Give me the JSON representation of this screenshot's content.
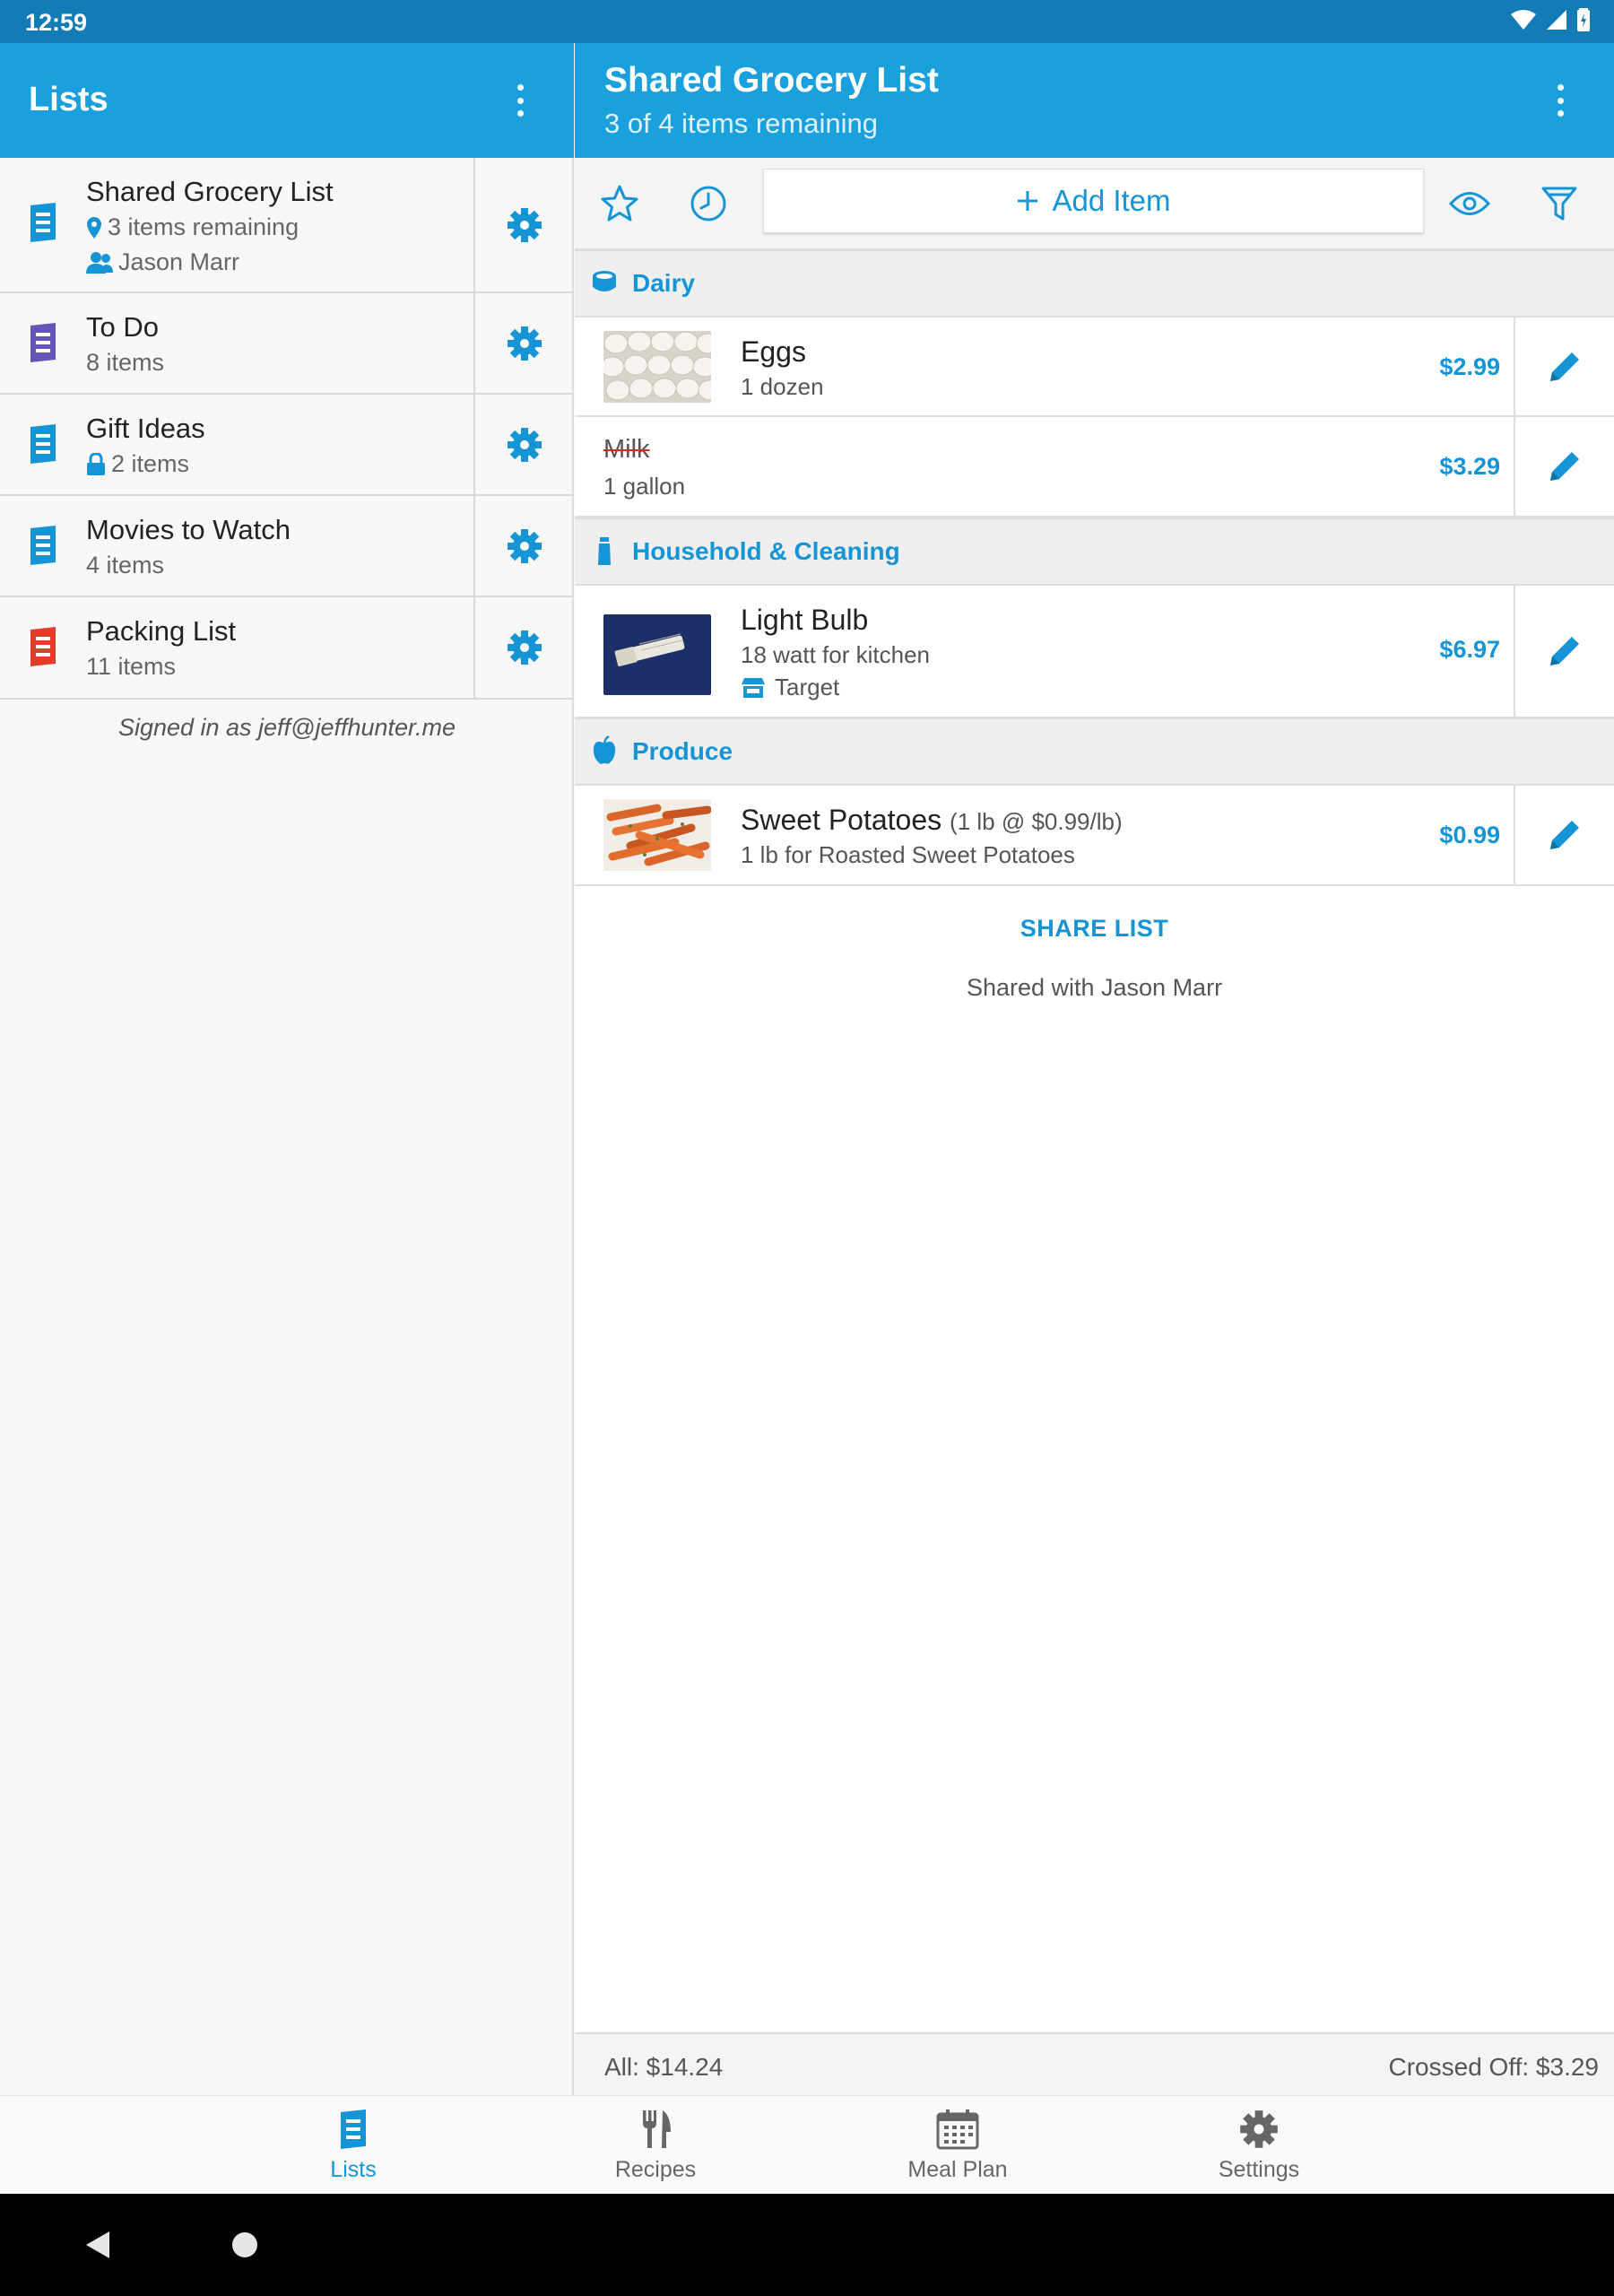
{
  "status": {
    "time": "12:59"
  },
  "left_header": {
    "title": "Lists"
  },
  "right_header": {
    "title": "Shared Grocery List",
    "subtitle": "3 of 4 items remaining"
  },
  "lists": [
    {
      "title": "Shared Grocery List",
      "subtitle": "3 items remaining",
      "extra": "Jason Marr",
      "color": "#1595d5",
      "subtitle_icon": "location-pin-icon",
      "extra_icon": "people-icon"
    },
    {
      "title": "To Do",
      "subtitle": "8 items",
      "color": "#6654b8"
    },
    {
      "title": "Gift Ideas",
      "subtitle": "2 items",
      "color": "#1595d5",
      "subtitle_icon": "lock-icon"
    },
    {
      "title": "Movies to Watch",
      "subtitle": "4 items",
      "color": "#1595d5"
    },
    {
      "title": "Packing List",
      "subtitle": "11 items",
      "color": "#e23d2b"
    }
  ],
  "signed_in": "Signed in as jeff@jeffhunter.me",
  "toolbar": {
    "add_item": "Add Item"
  },
  "categories": [
    {
      "name": "Dairy",
      "icon": "dairy-icon"
    },
    {
      "name": "Household & Cleaning",
      "icon": "cleaning-bottle-icon"
    },
    {
      "name": "Produce",
      "icon": "apple-icon"
    }
  ],
  "items": [
    {
      "name": "Eggs",
      "note": "1 dozen",
      "price": "$2.99"
    },
    {
      "name": "Milk",
      "note": "1 gallon",
      "price": "$3.29",
      "crossed_off": true
    },
    {
      "name": "Light Bulb",
      "note": "18 watt for kitchen",
      "store": "Target",
      "price": "$6.97"
    },
    {
      "name": "Sweet Potatoes",
      "detail": "(1 lb @ $0.99/lb)",
      "note": "1 lb for Roasted Sweet Potatoes",
      "price": "$0.99"
    }
  ],
  "share": {
    "button": "SHARE LIST",
    "shared_with": "Shared with Jason Marr"
  },
  "totals": {
    "all": "All: $14.24",
    "crossed": "Crossed Off: $3.29"
  },
  "bottom_nav": [
    {
      "label": "Lists",
      "icon": "lists-icon",
      "active": true
    },
    {
      "label": "Recipes",
      "icon": "fork-knife-icon"
    },
    {
      "label": "Meal Plan",
      "icon": "calendar-icon"
    },
    {
      "label": "Settings",
      "icon": "gear-icon"
    }
  ],
  "colors": {
    "primary": "#19a0dd",
    "status_bar": "#137bb6",
    "accent": "#1595d5",
    "strike": "#d62b1f"
  }
}
